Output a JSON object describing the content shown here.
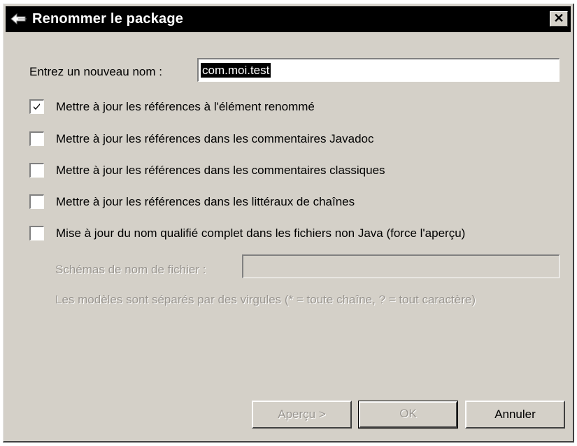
{
  "window": {
    "title": "Renommer le package",
    "close_glyph": "✕",
    "title_icon": "rename-package-icon"
  },
  "form": {
    "new_name_label": "Entrez un nouveau nom :",
    "new_name_value": "com.moi.test"
  },
  "options": [
    {
      "label": "Mettre à jour les références à l'élément renommé",
      "checked": true
    },
    {
      "label": "Mettre à jour les références dans les commentaires Javadoc",
      "checked": false
    },
    {
      "label": "Mettre à jour les références dans les commentaires classiques",
      "checked": false
    },
    {
      "label": "Mettre à jour les références dans les littéraux de chaînes",
      "checked": false
    },
    {
      "label": "Mise à jour du nom qualifié complet dans les fichiers non Java (force l'aperçu)",
      "checked": false
    }
  ],
  "patterns": {
    "label": "Schémas de nom de fichier :",
    "value": "",
    "hint": "Les modèles sont séparés par des virgules (* = toute chaîne, ? = tout caractère)"
  },
  "buttons": {
    "preview": "Aperçu >",
    "ok": "OK",
    "cancel": "Annuler"
  }
}
